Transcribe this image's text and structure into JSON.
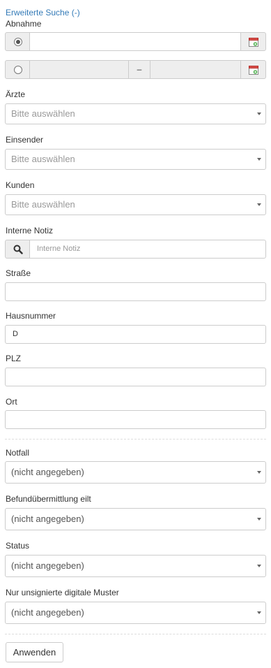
{
  "header": {
    "toggle_label": "Erweiterte Suche (-)"
  },
  "abnahme": {
    "label": "Abnahme",
    "single_value": "",
    "range_separator": "–",
    "range_from": "",
    "range_to": ""
  },
  "aerzte": {
    "label": "Ärzte",
    "value": "Bitte auswählen"
  },
  "einsender": {
    "label": "Einsender",
    "value": "Bitte auswählen"
  },
  "kunden": {
    "label": "Kunden",
    "value": "Bitte auswählen"
  },
  "interne_notiz": {
    "label": "Interne Notiz",
    "placeholder": "Interne Notiz"
  },
  "strasse": {
    "label": "Straße",
    "value": ""
  },
  "hausnummer": {
    "label": "Hausnummer",
    "value": "D"
  },
  "plz": {
    "label": "PLZ",
    "value": ""
  },
  "ort": {
    "label": "Ort",
    "value": ""
  },
  "notfall": {
    "label": "Notfall",
    "value": "(nicht angegeben)"
  },
  "befund": {
    "label": "Befundübermittlung eilt",
    "value": "(nicht angegeben)"
  },
  "status": {
    "label": "Status",
    "value": "(nicht angegeben)"
  },
  "unsigniert": {
    "label": "Nur unsignierte digitale Muster",
    "value": "(nicht angegeben)"
  },
  "actions": {
    "apply_label": "Anwenden"
  },
  "icons": {
    "calendar": "calendar-icon",
    "search": "search-icon",
    "caret": "caret-down-icon"
  },
  "colors": {
    "link": "#337ab7",
    "border": "#cccccc",
    "addon_bg": "#eeeeee"
  }
}
